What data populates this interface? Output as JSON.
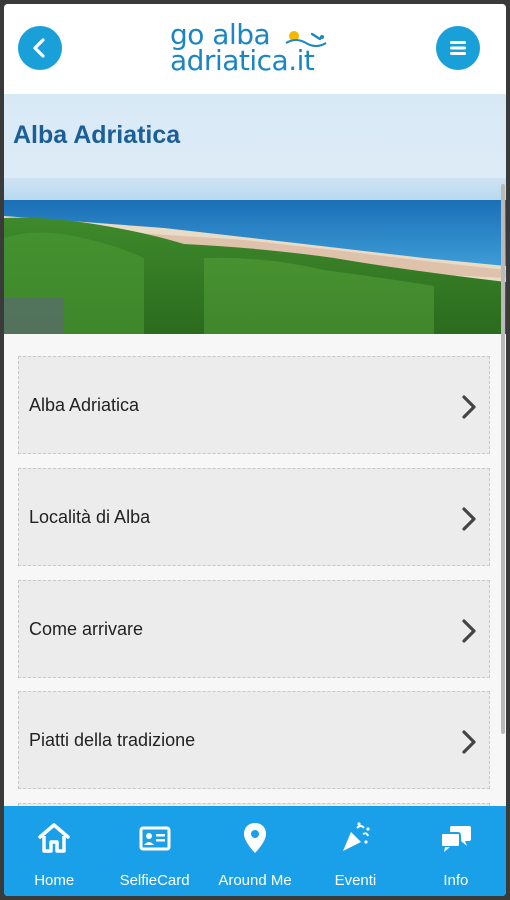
{
  "header": {
    "logo_line1": "go alba",
    "logo_line2": "adriatica.it",
    "back_icon": "chevron-left-icon",
    "menu_icon": "hamburger-menu-icon"
  },
  "hero": {
    "title": "Alba Adriatica"
  },
  "list": {
    "items": [
      {
        "label": "Alba Adriatica"
      },
      {
        "label": "Località di Alba"
      },
      {
        "label": "Come arrivare"
      },
      {
        "label": "Piatti della tradizione"
      }
    ]
  },
  "tabbar": {
    "items": [
      {
        "label": "Home",
        "icon": "home-icon"
      },
      {
        "label": "SelfieCard",
        "icon": "id-card-icon"
      },
      {
        "label": "Around Me",
        "icon": "location-pin-icon"
      },
      {
        "label": "Eventi",
        "icon": "party-popper-icon"
      },
      {
        "label": "Info",
        "icon": "chat-bubbles-icon"
      }
    ]
  },
  "colors": {
    "accent": "#1aa0d8",
    "tabbar": "#1aa0e8",
    "title": "#1b5f96"
  }
}
